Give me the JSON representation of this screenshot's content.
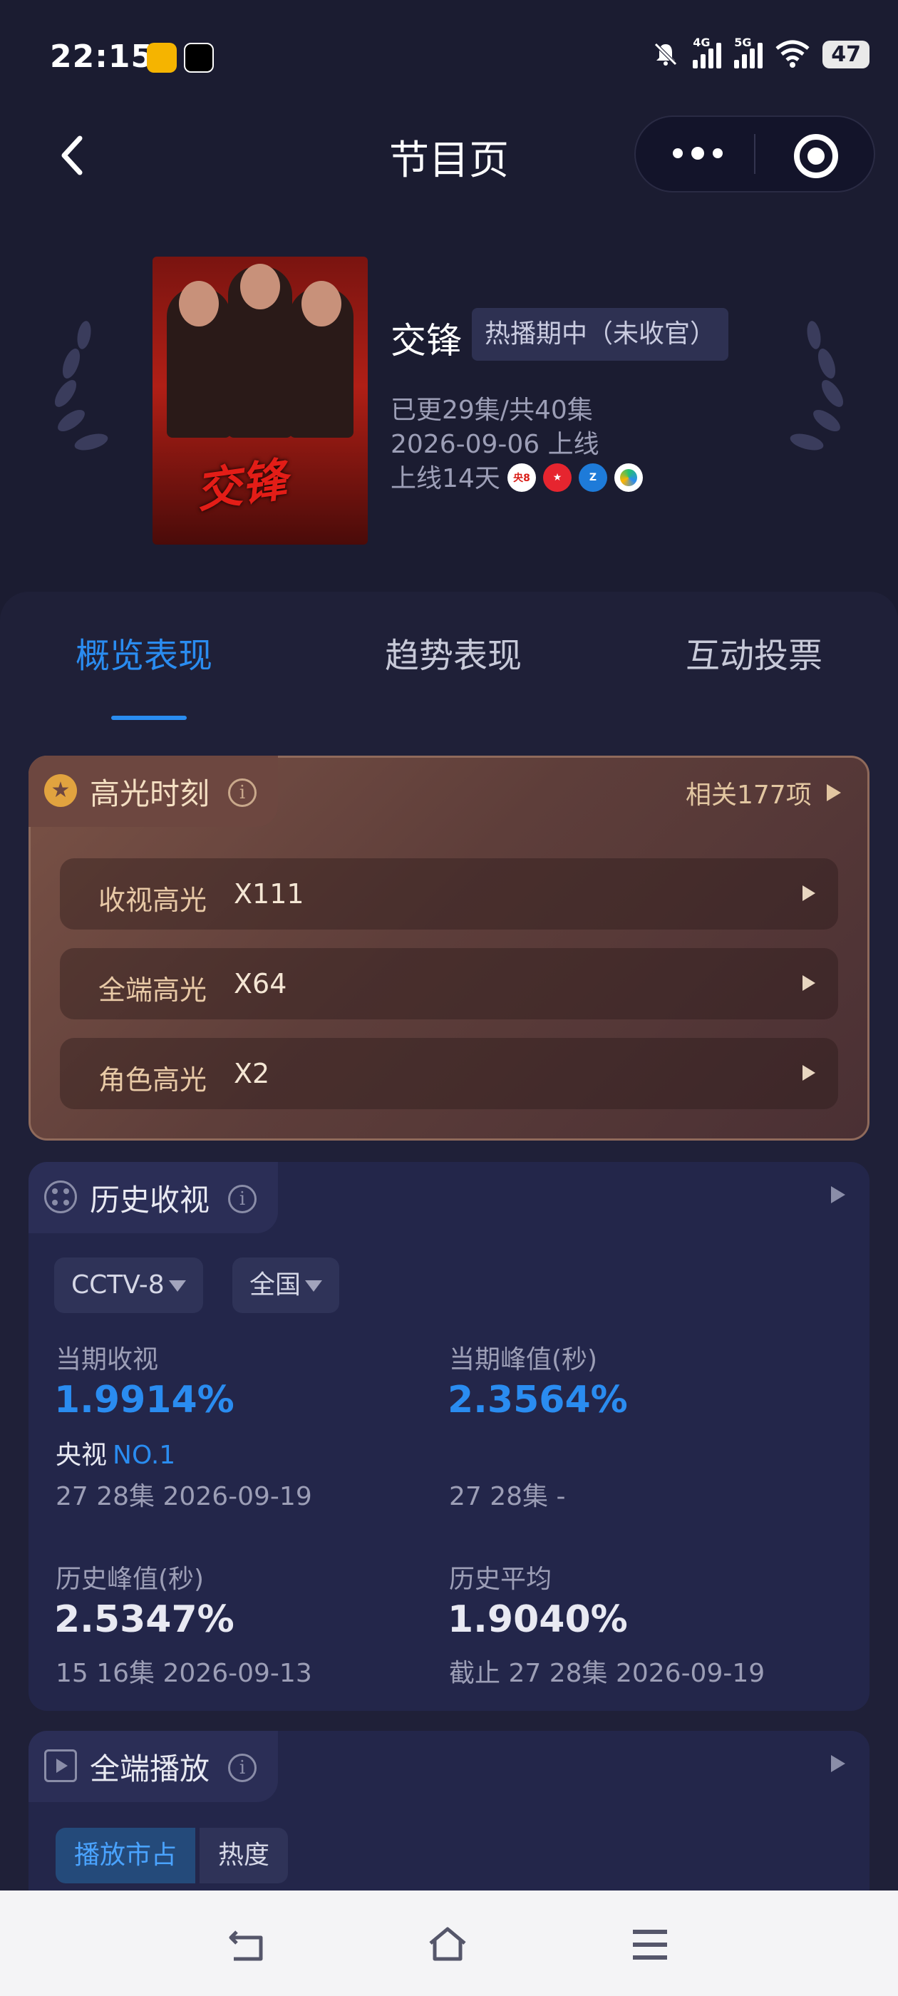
{
  "status_bar": {
    "time": "22:15",
    "network_1": "4G",
    "network_2": "5G",
    "battery": "47"
  },
  "header": {
    "title": "节目页"
  },
  "show": {
    "poster_title": "交锋",
    "title": "交锋",
    "status_tag": "热播期中（未收官）",
    "episodes": "已更29集/共40集",
    "premiere": "2026-09-06 上线",
    "days_online": "上线14天",
    "channels": [
      {
        "name": "cctv8-icon",
        "label": "央8"
      },
      {
        "name": "dragon-tv-icon",
        "label": "★"
      },
      {
        "name": "zhejiang-tv-icon",
        "label": "Z"
      },
      {
        "name": "streaming-app-icon",
        "label": ""
      }
    ]
  },
  "tabs": [
    {
      "label": "概览表现",
      "active": true
    },
    {
      "label": "趋势表现",
      "active": false
    },
    {
      "label": "互动投票",
      "active": false
    }
  ],
  "highlights": {
    "title": "高光时刻",
    "related": "相关177项",
    "rows": [
      {
        "label": "收视高光",
        "value": "X111"
      },
      {
        "label": "全端高光",
        "value": "X64"
      },
      {
        "label": "角色高光",
        "value": "X2"
      }
    ]
  },
  "ratings": {
    "title": "历史收视",
    "channel_select": "CCTV-8",
    "region_select": "全国",
    "current_label": "当期收视",
    "current_value": "1.9914%",
    "rank_prefix": "央视",
    "rank_value": "NO.1",
    "current_sub": "27 28集 2026-09-19",
    "current_peak_label": "当期峰值(秒)",
    "current_peak_value": "2.3564%",
    "current_peak_sub": "27 28集 -",
    "hist_peak_label": "历史峰值(秒)",
    "hist_peak_value": "2.5347%",
    "hist_peak_sub": "15 16集 2026-09-13",
    "hist_avg_label": "历史平均",
    "hist_avg_value": "1.9040%",
    "hist_avg_sub": "截止 27 28集 2026-09-19"
  },
  "playback": {
    "title": "全端播放",
    "segments": [
      {
        "label": "播放市占",
        "active": true
      },
      {
        "label": "热度",
        "active": false
      }
    ]
  },
  "colors": {
    "background": "#1b1c31",
    "accent": "#2a8cf0",
    "highlight_card": "#6d4740"
  }
}
